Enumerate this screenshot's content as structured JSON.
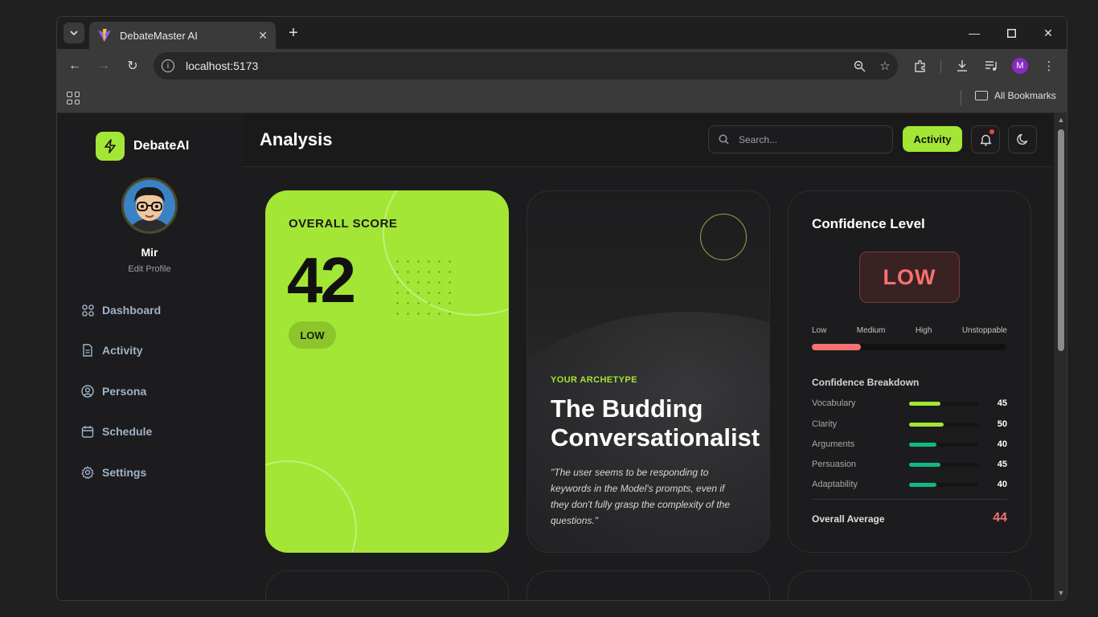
{
  "browser": {
    "tab_title": "DebateMaster AI",
    "url": "localhost:5173",
    "bookmarks_label": "All Bookmarks",
    "profile_initial": "M"
  },
  "sidebar": {
    "brand": "DebateAI",
    "user_name": "Mir",
    "edit_profile": "Edit Profile",
    "items": [
      {
        "label": "Dashboard",
        "icon": "grid-icon"
      },
      {
        "label": "Activity",
        "icon": "document-icon"
      },
      {
        "label": "Persona",
        "icon": "user-circle-icon"
      },
      {
        "label": "Schedule",
        "icon": "calendar-icon"
      },
      {
        "label": "Settings",
        "icon": "gear-icon"
      }
    ]
  },
  "header": {
    "title": "Analysis",
    "search_placeholder": "Search...",
    "activity_button": "Activity"
  },
  "score_card": {
    "label": "OVERALL SCORE",
    "value": "42",
    "badge": "LOW"
  },
  "archetype_card": {
    "kicker": "YOUR ARCHETYPE",
    "title": "The Budding Conversationalist",
    "quote": "\"The user seems to be responding to keywords in the Model's prompts, even if they don't fully grasp the complexity of the questions.\""
  },
  "confidence_card": {
    "title": "Confidence Level",
    "level": "LOW",
    "scale": [
      "Low",
      "Medium",
      "High",
      "Unstoppable"
    ],
    "level_fraction": 0.25,
    "breakdown_title": "Confidence Breakdown",
    "breakdown": [
      {
        "label": "Vocabulary",
        "value": "45",
        "color": "#a3e635"
      },
      {
        "label": "Clarity",
        "value": "50",
        "color": "#a3e635"
      },
      {
        "label": "Arguments",
        "value": "40",
        "color": "#10b981"
      },
      {
        "label": "Persuasion",
        "value": "45",
        "color": "#10b981"
      },
      {
        "label": "Adaptability",
        "value": "40",
        "color": "#10b981"
      }
    ],
    "average_label": "Overall Average",
    "average_value": "44"
  },
  "colors": {
    "accent": "#a3e635",
    "danger": "#f87171",
    "teal": "#10b981"
  }
}
